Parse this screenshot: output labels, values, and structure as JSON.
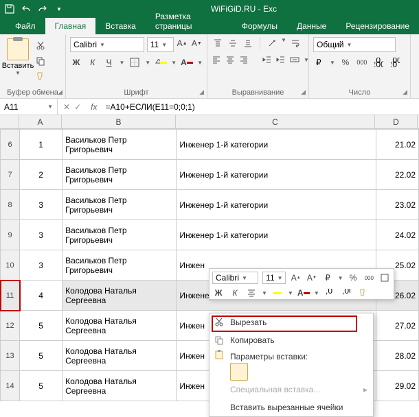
{
  "window": {
    "title": "WiFiGiD.RU - Exc"
  },
  "tabs": {
    "file": "Файл",
    "home": "Главная",
    "insert": "Вставка",
    "layout": "Разметка страницы",
    "formulas": "Формулы",
    "data": "Данные",
    "review": "Рецензирование"
  },
  "ribbon": {
    "clipboard": {
      "label": "Буфер обмена",
      "paste": "Вставить"
    },
    "font": {
      "label": "Шрифт",
      "name": "Calibri",
      "size": "11",
      "bold": "Ж",
      "italic": "К",
      "underline": "Ч"
    },
    "alignment": {
      "label": "Выравнивание"
    },
    "number": {
      "label": "Число",
      "format": "Общий"
    }
  },
  "namebox": "A11",
  "formula": "=A10+ЕСЛИ(E11=0;0;1)",
  "fx": "fx",
  "columns": {
    "A": "A",
    "B": "B",
    "C": "C",
    "D": "D"
  },
  "rows": [
    {
      "rh": "6",
      "a": "1",
      "b": "Васильков Петр Григорьевич",
      "c": "Инженер 1-й категории",
      "d": "21.02"
    },
    {
      "rh": "7",
      "a": "2",
      "b": "Васильков Петр Григорьевич",
      "c": "Инженер 1-й категории",
      "d": "22.02"
    },
    {
      "rh": "8",
      "a": "3",
      "b": "Васильков Петр Григорьевич",
      "c": "Инженер 1-й категории",
      "d": "23.02"
    },
    {
      "rh": "9",
      "a": "3",
      "b": "Васильков Петр Григорьевич",
      "c": "Инженер 1-й категории",
      "d": "24.02"
    },
    {
      "rh": "10",
      "a": "3",
      "b": "Васильков Петр Григорьевич",
      "c": "Инжен",
      "d": "25.02"
    },
    {
      "rh": "11",
      "a": "4",
      "b": "Колодова Наталья Сергеевна",
      "c": "Инженер",
      "d": "26.02",
      "sel": true
    },
    {
      "rh": "12",
      "a": "5",
      "b": "Колодова Наталья Сергеевна",
      "c": "Инжен",
      "d": "27.02"
    },
    {
      "rh": "13",
      "a": "5",
      "b": "Колодова Наталья Сергеевна",
      "c": "Инжен",
      "d": "28.02"
    },
    {
      "rh": "14",
      "a": "5",
      "b": "Колодова Наталья Сергеевна",
      "c": "Инжен",
      "d": "29.02"
    }
  ],
  "minibar": {
    "font": "Calibri",
    "size": "11",
    "bold": "Ж",
    "italic": "К",
    "pct": "%",
    "sep": "000"
  },
  "context": {
    "cut": "Вырезать",
    "copy": "Копировать",
    "pasteopts": "Параметры вставки:",
    "special": "Специальная вставка...",
    "insertcut": "Вставить вырезанные ячейки"
  }
}
